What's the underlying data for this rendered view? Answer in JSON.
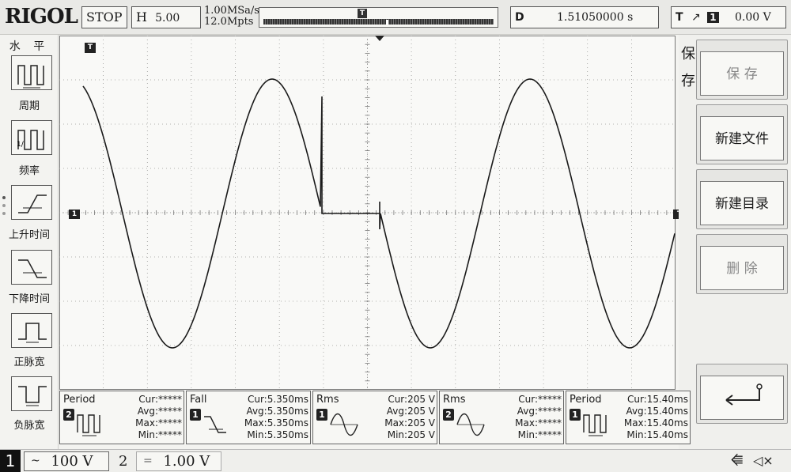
{
  "brand": "RIGOL",
  "status": "STOP",
  "timebase": {
    "prefix": "H",
    "value": "5.00 ms"
  },
  "acq": {
    "sample_rate": "1.00MSa/s",
    "memory_depth": "12.0Mpts"
  },
  "delay": {
    "prefix": "D",
    "value": "1.51050000 s"
  },
  "trigger": {
    "prefix": "T",
    "edge_symbol": "↗",
    "channel": "1",
    "level": "0.00 V"
  },
  "left_menu": {
    "title": "水 平",
    "items": [
      {
        "label": "周期",
        "icon": "period-icon"
      },
      {
        "label": "频率",
        "icon": "frequency-icon"
      },
      {
        "label": "上升时间",
        "icon": "rise-time-icon"
      },
      {
        "label": "下降时间",
        "icon": "fall-time-icon"
      },
      {
        "label": "正脉宽",
        "icon": "positive-width-icon"
      },
      {
        "label": "负脉宽",
        "icon": "negative-width-icon"
      }
    ]
  },
  "right_menu": {
    "title_top": "保",
    "title_bottom": "存",
    "buttons": [
      {
        "label": "保 存",
        "disabled": true
      },
      {
        "label": "新建文件",
        "disabled": false
      },
      {
        "label": "新建目录",
        "disabled": false
      },
      {
        "label": "删 除",
        "disabled": true
      },
      {
        "label": "↵",
        "icon": "enter-icon"
      }
    ]
  },
  "markers": {
    "trigger_top": "T",
    "ch1_left": "1",
    "trigger_right": "T"
  },
  "measurements": [
    {
      "name": "Period",
      "channel": "2",
      "icon": "period-icon",
      "cur": "Cur:*****",
      "avg": "Avg:*****",
      "max": "Max:*****",
      "min": "Min:*****"
    },
    {
      "name": "Fall",
      "channel": "1",
      "icon": "fall-time-icon",
      "cur": "Cur:5.350ms",
      "avg": "Avg:5.350ms",
      "max": "Max:5.350ms",
      "min": "Min:5.350ms"
    },
    {
      "name": "Rms",
      "channel": "1",
      "icon": "rms-icon",
      "cur": "Cur:205 V",
      "avg": "Avg:205 V",
      "max": "Max:205 V",
      "min": "Min:205 V"
    },
    {
      "name": "Rms",
      "channel": "2",
      "icon": "rms-icon",
      "cur": "Cur:*****",
      "avg": "Avg:*****",
      "max": "Max:*****",
      "min": "Min:*****"
    },
    {
      "name": "Period",
      "channel": "1",
      "icon": "period-icon",
      "cur": "Cur:15.40ms",
      "avg": "Avg:15.40ms",
      "max": "Max:15.40ms",
      "min": "Min:15.40ms"
    }
  ],
  "channels": [
    {
      "num": "1",
      "coupling": "~",
      "scale": "100 V",
      "active": true
    },
    {
      "num": "2",
      "coupling": "=",
      "scale": "1.00 V",
      "active": false
    }
  ],
  "status_icons": {
    "usb": "usb-icon",
    "sound": "mute-icon"
  }
}
